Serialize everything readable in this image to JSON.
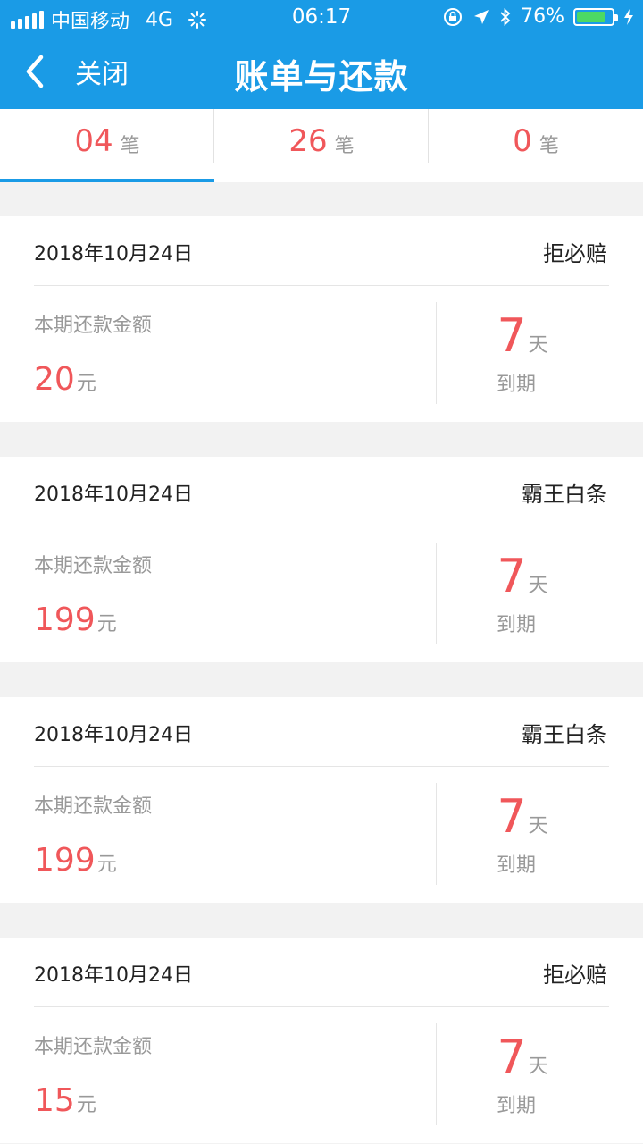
{
  "status": {
    "carrier": "中国移动",
    "network": "4G",
    "time": "06:17",
    "battery": "76%"
  },
  "nav": {
    "back_label": "关闭",
    "title": "账单与还款"
  },
  "tabs": [
    {
      "count": "04",
      "unit": "笔"
    },
    {
      "count": "26",
      "unit": "笔"
    },
    {
      "count": "0",
      "unit": "笔"
    }
  ],
  "bills": [
    {
      "date": "2018年10月24日",
      "lender": "拒必赔",
      "amount_label": "本期还款金额",
      "amount": "20",
      "currency": "元",
      "days": "7",
      "day_unit": "天",
      "due_label": "到期"
    },
    {
      "date": "2018年10月24日",
      "lender": "霸王白条",
      "amount_label": "本期还款金额",
      "amount": "199",
      "currency": "元",
      "days": "7",
      "day_unit": "天",
      "due_label": "到期"
    },
    {
      "date": "2018年10月24日",
      "lender": "霸王白条",
      "amount_label": "本期还款金额",
      "amount": "199",
      "currency": "元",
      "days": "7",
      "day_unit": "天",
      "due_label": "到期"
    },
    {
      "date": "2018年10月24日",
      "lender": "拒必赔",
      "amount_label": "本期还款金额",
      "amount": "15",
      "currency": "元",
      "days": "7",
      "day_unit": "天",
      "due_label": "到期"
    }
  ],
  "colors": {
    "brand": "#1a9be6",
    "accent": "#f0575a",
    "battery": "#4cd964"
  }
}
